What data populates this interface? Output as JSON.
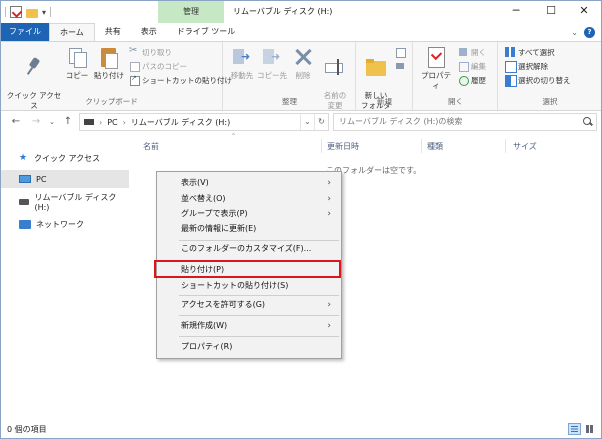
{
  "window": {
    "title": "リムーバブル ディスク (H:)",
    "context_tab": "管理",
    "minimize": "─",
    "maximize": "☐",
    "close": "✕"
  },
  "tabs": {
    "file": "ファイル",
    "home": "ホーム",
    "share": "共有",
    "view": "表示",
    "drive_tools": "ドライブ ツール"
  },
  "ribbon": {
    "clipboard": {
      "label": "クリップボード",
      "pin": "クイック アクセス\nにピン留めする",
      "copy": "コピー",
      "paste": "貼り付け",
      "cut": "切り取り",
      "copy_path": "パスのコピー",
      "paste_shortcut": "ショートカットの貼り付け"
    },
    "organize": {
      "label": "整理",
      "move_to": "移動先",
      "copy_to": "コピー先",
      "delete": "削除",
      "rename": "名前の\n変更"
    },
    "new": {
      "label": "新規",
      "new_folder": "新しい\nフォルダー"
    },
    "open": {
      "label": "開く",
      "properties": "プロパティ",
      "open": "開く",
      "edit": "編集",
      "history": "履歴"
    },
    "select": {
      "label": "選択",
      "select_all": "すべて選択",
      "select_none": "選択解除",
      "invert": "選択の切り替え"
    }
  },
  "address": {
    "path_root": "PC",
    "path_drive": "リムーバブル ディスク (H:)",
    "search_placeholder": "リムーバブル ディスク (H:)の検索"
  },
  "nav": {
    "items": [
      {
        "label": "クイック アクセス"
      },
      {
        "label": "PC"
      },
      {
        "label": "リムーバブル ディスク (H:)"
      },
      {
        "label": "ネットワーク"
      }
    ]
  },
  "columns": {
    "name": "名前",
    "modified": "更新日時",
    "type": "種類",
    "size": "サイズ"
  },
  "empty_message": "このフォルダーは空です。",
  "context_menu": {
    "view": "表示(V)",
    "sort": "並べ替え(O)",
    "group": "グループで表示(P)",
    "refresh": "最新の情報に更新(E)",
    "customize": "このフォルダーのカスタマイズ(F)...",
    "paste": "貼り付け(P)",
    "paste_shortcut": "ショートカットの貼り付け(S)",
    "give_access": "アクセスを許可する(G)",
    "new": "新規作成(W)",
    "properties": "プロパティ(R)"
  },
  "status": {
    "item_count": "0 個の項目"
  }
}
